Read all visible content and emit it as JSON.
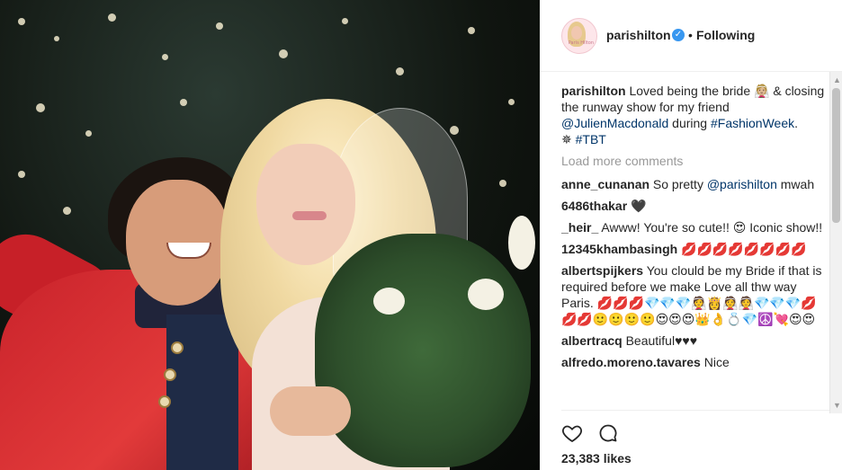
{
  "header": {
    "username": "parishilton",
    "verified_mark": "✓",
    "separator": "•",
    "follow_status": "Following"
  },
  "avatar": {
    "text": "Paris Hilton"
  },
  "caption": {
    "username": "parishilton",
    "text_part1": "Loved being the bride ",
    "emoji": "👰🏼",
    "text_part2": " & closing the runway show for my friend ",
    "mention": "@JulienMacdonald",
    "text_part3": " during ",
    "hashtag1": "#FashionWeek",
    "text_part4": ".",
    "emoji2": "✵",
    "hashtag2": "#TBT"
  },
  "load_more": "Load more comments",
  "comments": [
    {
      "user": "anne_cunanan",
      "text": "So pretty ",
      "mention": "@parishilton",
      "after": " mwah"
    },
    {
      "user": "6486thakar",
      "text": "🖤",
      "mention": "",
      "after": ""
    },
    {
      "user": "_heir_",
      "text": "Awww! You're so cute!! 😍 Iconic show!!",
      "mention": "",
      "after": ""
    },
    {
      "user": "12345khambasingh",
      "text": "💋💋💋💋💋💋💋💋",
      "mention": "",
      "after": ""
    },
    {
      "user": "albertspijkers",
      "text": "You clould be my Bride if that is required before we make Love all thw way Paris. 💋💋💋💎💎💎👰👸👰👰💎💎💎💋💋💋🙂🙂🙂🙂😍😍😍👑👌💍💎☮️💘😍😍",
      "mention": "",
      "after": ""
    },
    {
      "user": "albertracq",
      "text": "Beautiful♥♥♥",
      "mention": "",
      "after": ""
    },
    {
      "user": "alfredo.moreno.tavares",
      "text": "Nice",
      "mention": "",
      "after": ""
    }
  ],
  "actions": {
    "like_icon": "heart-icon",
    "comment_icon": "comment-icon"
  },
  "likes": "23,383 likes",
  "colors": {
    "link": "#003569",
    "verified": "#3897f0",
    "muted": "#999999"
  }
}
